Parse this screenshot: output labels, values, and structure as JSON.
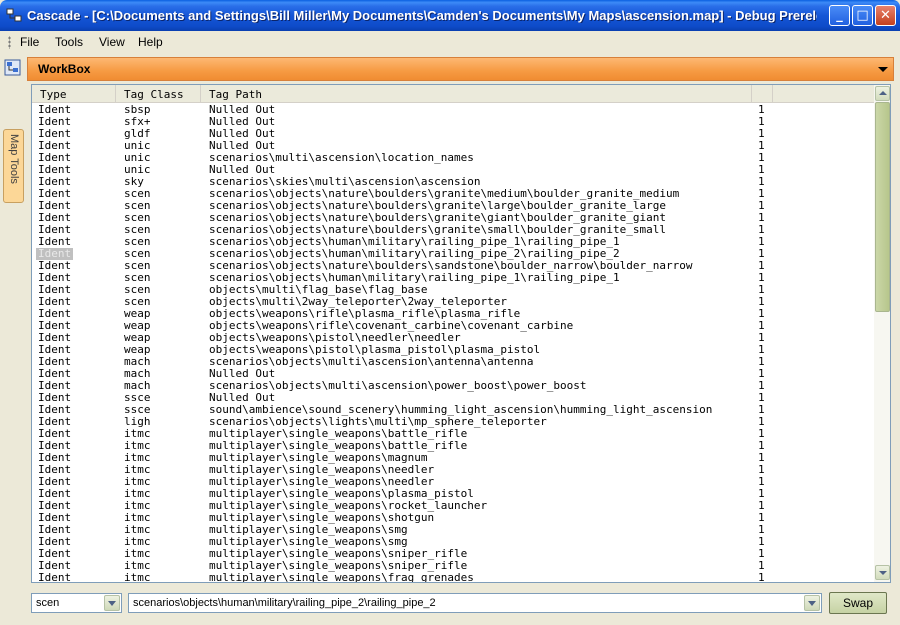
{
  "window": {
    "title": "Cascade - [C:\\Documents and Settings\\Bill Miller\\My Documents\\Camden's Documents\\My Maps\\ascension.map] - Debug Prerele...",
    "minimize_label": "_",
    "maximize_label": "□",
    "close_label": "✕"
  },
  "menu": {
    "items": [
      "File",
      "Tools",
      "View",
      "Help"
    ]
  },
  "left_strip": {
    "tab_label": "Map Tools"
  },
  "workbox": {
    "title": "WorkBox"
  },
  "table": {
    "headers": [
      "Type",
      "Tag Class",
      "Tag Path",
      "",
      ""
    ],
    "rows": [
      [
        "Ident",
        "sbsp",
        "Nulled Out",
        "1"
      ],
      [
        "Ident",
        "sfx+",
        "Nulled Out",
        "1"
      ],
      [
        "Ident",
        "gldf",
        "Nulled Out",
        "1"
      ],
      [
        "Ident",
        "unic",
        "Nulled Out",
        "1"
      ],
      [
        "Ident",
        "unic",
        "scenarios\\multi\\ascension\\location_names",
        "1"
      ],
      [
        "Ident",
        "unic",
        "Nulled Out",
        "1"
      ],
      [
        "Ident",
        "sky",
        "scenarios\\skies\\multi\\ascension\\ascension",
        "1"
      ],
      [
        "Ident",
        "scen",
        "scenarios\\objects\\nature\\boulders\\granite\\medium\\boulder_granite_medium",
        "1"
      ],
      [
        "Ident",
        "scen",
        "scenarios\\objects\\nature\\boulders\\granite\\large\\boulder_granite_large",
        "1"
      ],
      [
        "Ident",
        "scen",
        "scenarios\\objects\\nature\\boulders\\granite\\giant\\boulder_granite_giant",
        "1"
      ],
      [
        "Ident",
        "scen",
        "scenarios\\objects\\nature\\boulders\\granite\\small\\boulder_granite_small",
        "1"
      ],
      [
        "Ident",
        "scen",
        "scenarios\\objects\\human\\military\\railing_pipe_1\\railing_pipe_1",
        "1"
      ],
      [
        "Ident",
        "scen",
        "scenarios\\objects\\human\\military\\railing_pipe_2\\railing_pipe_2",
        "1"
      ],
      [
        "Ident",
        "scen",
        "scenarios\\objects\\nature\\boulders\\sandstone\\boulder_narrow\\boulder_narrow",
        "1"
      ],
      [
        "Ident",
        "scen",
        "scenarios\\objects\\human\\military\\railing_pipe_1\\railing_pipe_1",
        "1"
      ],
      [
        "Ident",
        "scen",
        "objects\\multi\\flag_base\\flag_base",
        "1"
      ],
      [
        "Ident",
        "scen",
        "objects\\multi\\2way_teleporter\\2way_teleporter",
        "1"
      ],
      [
        "Ident",
        "weap",
        "objects\\weapons\\rifle\\plasma_rifle\\plasma_rifle",
        "1"
      ],
      [
        "Ident",
        "weap",
        "objects\\weapons\\rifle\\covenant_carbine\\covenant_carbine",
        "1"
      ],
      [
        "Ident",
        "weap",
        "objects\\weapons\\pistol\\needler\\needler",
        "1"
      ],
      [
        "Ident",
        "weap",
        "objects\\weapons\\pistol\\plasma_pistol\\plasma_pistol",
        "1"
      ],
      [
        "Ident",
        "mach",
        "scenarios\\objects\\multi\\ascension\\antenna\\antenna",
        "1"
      ],
      [
        "Ident",
        "mach",
        "Nulled Out",
        "1"
      ],
      [
        "Ident",
        "mach",
        "scenarios\\objects\\multi\\ascension\\power_boost\\power_boost",
        "1"
      ],
      [
        "Ident",
        "ssce",
        "Nulled Out",
        "1"
      ],
      [
        "Ident",
        "ssce",
        "sound\\ambience\\sound_scenery\\humming_light_ascension\\humming_light_ascension",
        "1"
      ],
      [
        "Ident",
        "ligh",
        "scenarios\\objects\\lights\\multi\\mp_sphere_teleporter",
        "1"
      ],
      [
        "Ident",
        "itmc",
        "multiplayer\\single_weapons\\battle_rifle",
        "1"
      ],
      [
        "Ident",
        "itmc",
        "multiplayer\\single_weapons\\battle_rifle",
        "1"
      ],
      [
        "Ident",
        "itmc",
        "multiplayer\\single_weapons\\magnum",
        "1"
      ],
      [
        "Ident",
        "itmc",
        "multiplayer\\single_weapons\\needler",
        "1"
      ],
      [
        "Ident",
        "itmc",
        "multiplayer\\single_weapons\\needler",
        "1"
      ],
      [
        "Ident",
        "itmc",
        "multiplayer\\single_weapons\\plasma_pistol",
        "1"
      ],
      [
        "Ident",
        "itmc",
        "multiplayer\\single_weapons\\rocket_launcher",
        "1"
      ],
      [
        "Ident",
        "itmc",
        "multiplayer\\single_weapons\\shotgun",
        "1"
      ],
      [
        "Ident",
        "itmc",
        "multiplayer\\single_weapons\\smg",
        "1"
      ],
      [
        "Ident",
        "itmc",
        "multiplayer\\single_weapons\\smg",
        "1"
      ],
      [
        "Ident",
        "itmc",
        "multiplayer\\single_weapons\\sniper_rifle",
        "1"
      ],
      [
        "Ident",
        "itmc",
        "multiplayer\\single_weapons\\sniper_rifle",
        "1"
      ],
      [
        "Ident",
        "itmc",
        "multiplayer\\single_weapons\\frag_grenades",
        "1"
      ]
    ],
    "selected_row": 12
  },
  "bottom": {
    "tag_class_value": "scen",
    "tag_path_value": "scenarios\\objects\\human\\military\\railing_pipe_2\\railing_pipe_2",
    "swap_label": "Swap"
  },
  "colors": {
    "titlebar": "#1556d6",
    "workbox_header": "#f69a42",
    "selection": "#c0c0c0"
  }
}
